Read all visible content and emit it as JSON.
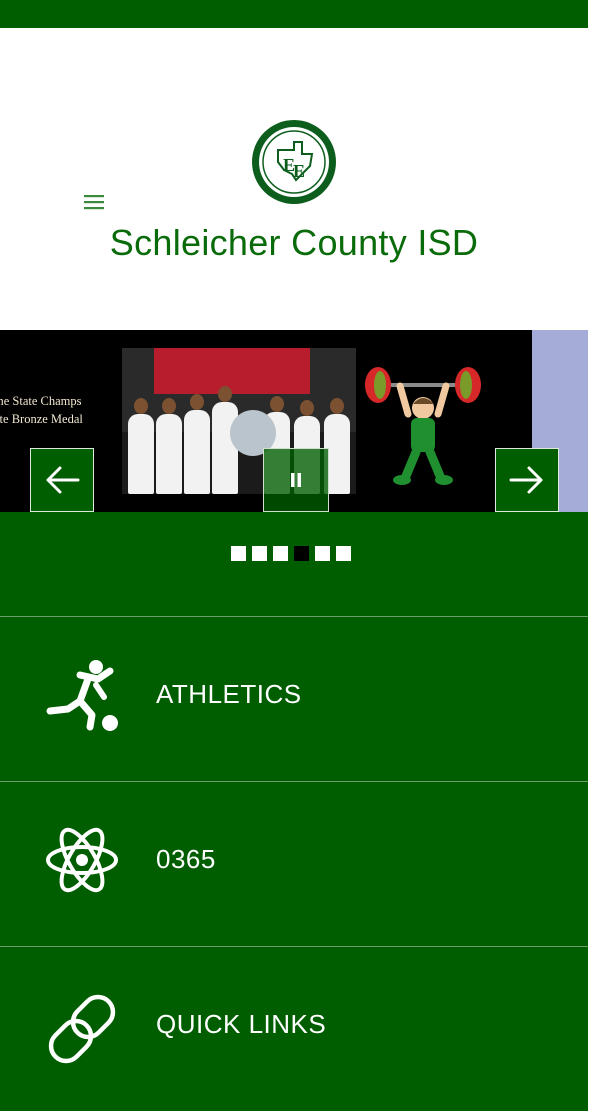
{
  "header": {
    "site_title": "Schleicher County ISD",
    "menu_icon": "hamburger-icon",
    "logo_icon": "district-seal-icon"
  },
  "slider": {
    "caption_lines": [
      "me State Champs",
      "ate Bronze Medal"
    ],
    "prev_icon": "arrow-left-icon",
    "next_icon": "arrow-right-icon",
    "pause_icon": "pause-icon",
    "slide_count": 6,
    "active_slide": 4
  },
  "quick_tiles": [
    {
      "label": "ATHLETICS",
      "icon": "runner-soccer-icon"
    },
    {
      "label": "0365",
      "icon": "atom-icon"
    },
    {
      "label": "QUICK LINKS",
      "icon": "link-icon"
    }
  ],
  "colors": {
    "brand_green": "#005e00",
    "title_green": "#0a6b0a",
    "white": "#ffffff"
  }
}
